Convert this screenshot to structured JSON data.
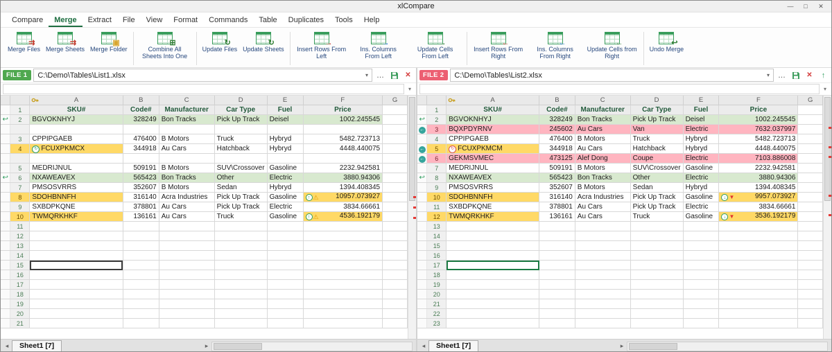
{
  "window": {
    "title": "xlCompare",
    "min": "—",
    "max": "□",
    "close": "✕"
  },
  "colors": {
    "menu-active": "#1e6e41",
    "tb-text": "#26477d",
    "row-green": "#d8e9cf",
    "row-pink": "#ffb5c0",
    "cell-orange": "#ffd966",
    "grid-line": "#d8d8d8",
    "hdr-green": "#21593a",
    "file1-badge": "#4fa84f",
    "file2-badge": "#ec5f72"
  },
  "menu": [
    {
      "label": "Compare"
    },
    {
      "label": "Merge",
      "active": true
    },
    {
      "label": "Extract"
    },
    {
      "label": "File"
    },
    {
      "label": "View"
    },
    {
      "label": "Format"
    },
    {
      "label": "Commands"
    },
    {
      "label": "Table"
    },
    {
      "label": "Duplicates"
    },
    {
      "label": "Tools"
    },
    {
      "label": "Help"
    }
  ],
  "toolbar": [
    {
      "label": "Merge Files",
      "icon": "merge-files",
      "glyph": "⇉",
      "color": "#c0392b"
    },
    {
      "label": "Merge Sheets",
      "icon": "merge-sheets",
      "glyph": "⇉",
      "color": "#c0392b"
    },
    {
      "label": "Merge Folder",
      "icon": "merge-folder",
      "glyph": "▣",
      "color": "#d9a62e",
      "sep": true
    },
    {
      "label": "Combine All Sheets Into One",
      "icon": "combine-sheets",
      "glyph": "⊞",
      "color": "#2e7d32",
      "sep": true
    },
    {
      "label": "Update Files",
      "icon": "update-files",
      "glyph": "↻",
      "color": "#2e7d32"
    },
    {
      "label": "Update Sheets",
      "icon": "update-sheets",
      "glyph": "↻",
      "color": "#2e7d32",
      "sep": true
    },
    {
      "label": "Insert Rows From Left",
      "icon": "insert-rows-left",
      "glyph": "→",
      "color": "#c0392b"
    },
    {
      "label": "Ins. Columns From Left",
      "icon": "insert-columns-left",
      "glyph": "→",
      "color": "#1d6fd1"
    },
    {
      "label": "Update Cells From Left",
      "icon": "update-cells-left",
      "glyph": "→",
      "color": "#2e7d32",
      "sep": true
    },
    {
      "label": "Insert Rows From Right",
      "icon": "insert-rows-right",
      "glyph": "←",
      "color": "#c0392b"
    },
    {
      "label": "Ins. Columns From Right",
      "icon": "insert-columns-right",
      "glyph": "←",
      "color": "#1d6fd1"
    },
    {
      "label": "Update Cells from Right",
      "icon": "update-cells-right",
      "glyph": "←",
      "color": "#2e7d32",
      "sep": true
    },
    {
      "label": "Undo Merge",
      "icon": "undo-merge",
      "glyph": "↩",
      "color": "#2e7d32"
    }
  ],
  "panels": [
    {
      "badge": "FILE 1",
      "badge_color": "#4fa84f",
      "path": "C:\\Demo\\Tables\\List1.xlsx",
      "actions": [
        "ellipsis",
        "save",
        "close"
      ],
      "columns": [
        "A",
        "B",
        "C",
        "D",
        "E",
        "F",
        "G"
      ],
      "key_column": "A",
      "tab": "Sheet1 [7]",
      "sel_row": "15",
      "sel_style": "dark",
      "marks": [
        145,
        160,
        175
      ],
      "rows": [
        {
          "n": "1",
          "h": 1,
          "c": [
            "SKU#",
            "Code#",
            "Manufacturer",
            "Car Type",
            "Fuel",
            "Price"
          ]
        },
        {
          "n": "2",
          "g": "undo",
          "bg": "g",
          "c": [
            "BGVOKNHYJ",
            "328249",
            "Bon Tracks",
            "Pick Up Track",
            "Deisel",
            "1002.245545"
          ]
        },
        {
          "sp": 1
        },
        {
          "n": "3",
          "c": [
            "CPPIPGAEB",
            "476400",
            "B Motors",
            "Truck",
            "Hybryd",
            "5482.723713"
          ]
        },
        {
          "n": "4",
          "nbg": "o",
          "c": [
            {
              "v": "FCUXPKMCX",
              "bg": "o",
              "mk": "g"
            },
            "344918",
            "Au Cars",
            "Hatchback",
            "Hybryd",
            "4448.440075"
          ]
        },
        {
          "sp": 1
        },
        {
          "n": "5",
          "c": [
            "MEDRIJNUL",
            "509191",
            "B Motors",
            "SUV\\Crossover",
            "Gasoline",
            "2232.942581"
          ]
        },
        {
          "n": "6",
          "g": "undo",
          "bg": "g",
          "c": [
            "NXAWEAVEX",
            "565423",
            "Bon Tracks",
            "Other",
            "Electric",
            "3880.94306"
          ]
        },
        {
          "n": "7",
          "c": [
            "PMSOSVRRS",
            "352607",
            "B Motors",
            "Sedan",
            "Hybryd",
            "1394.408345"
          ]
        },
        {
          "n": "8",
          "nbg": "o",
          "c": [
            {
              "v": "SDOHBNNFH",
              "bg": "o"
            },
            "316140",
            "Acra Industries",
            "Pick Up Track",
            "Gasoline",
            {
              "v": "10957.073927",
              "bg": "o",
              "bd": "wu"
            }
          ]
        },
        {
          "n": "9",
          "c": [
            "SXBDPKQNE",
            "378801",
            "Au Cars",
            "Pick Up Track",
            "Electric",
            "3834.66661"
          ]
        },
        {
          "n": "10",
          "nbg": "o",
          "c": [
            {
              "v": "TWMQRKHKF",
              "bg": "o"
            },
            "136161",
            "Au Cars",
            "Truck",
            "Gasoline",
            {
              "v": "4536.192179",
              "bg": "o",
              "bd": "wu"
            }
          ]
        },
        {
          "n": "11"
        },
        {
          "n": "12"
        },
        {
          "n": "13"
        },
        {
          "n": "14"
        },
        {
          "n": "15"
        },
        {
          "n": "16"
        },
        {
          "n": "17"
        },
        {
          "n": "18"
        },
        {
          "n": "19"
        },
        {
          "n": "20"
        },
        {
          "n": "21"
        }
      ]
    },
    {
      "badge": "FILE 2",
      "badge_color": "#ec5f72",
      "path": "C:\\Demo\\Tables\\List2.xlsx",
      "actions": [
        "ellipsis",
        "save",
        "close",
        "up"
      ],
      "columns": [
        "A",
        "B",
        "C",
        "D",
        "E",
        "F",
        "G"
      ],
      "key_column": "A",
      "tab": "Sheet1 [7]",
      "sel_row": "17",
      "sel_style": "green",
      "marks": [
        45,
        73,
        87,
        143,
        171
      ],
      "rows": [
        {
          "n": "1",
          "h": 1,
          "c": [
            "SKU#",
            "Code#",
            "Manufacturer",
            "Car Type",
            "Fuel",
            "Price"
          ]
        },
        {
          "n": "2",
          "g": "undo",
          "bg": "g",
          "c": [
            "BGVOKNHYJ",
            "328249",
            "Bon Tracks",
            "Pick Up Track",
            "Deisel",
            "1002.245545"
          ]
        },
        {
          "n": "3",
          "g": "left",
          "nbg": "p",
          "bg": "p",
          "c": [
            "BQXPDYRNV",
            "245602",
            "Au Cars",
            "Van",
            "Electric",
            "7632.037997"
          ]
        },
        {
          "n": "4",
          "c": [
            "CPPIPGAEB",
            "476400",
            "B Motors",
            "Truck",
            "Hybryd",
            "5482.723713"
          ]
        },
        {
          "n": "5",
          "g": "left",
          "nbg": "o",
          "c": [
            {
              "v": "FCUXPKMCM",
              "bg": "o",
              "mk": "r"
            },
            "344918",
            "Au Cars",
            "Hatchback",
            "Hybryd",
            "4448.440075"
          ]
        },
        {
          "n": "6",
          "g": "left",
          "nbg": "p",
          "bg": "p",
          "c": [
            "GEKMSVMEC",
            "473125",
            "Alef Dong",
            "Coupe",
            "Electric",
            "7103.886008"
          ]
        },
        {
          "n": "7",
          "c": [
            "MEDRIJNUL",
            "509191",
            "B Motors",
            "SUV\\Crossover",
            "Gasoline",
            "2232.942581"
          ]
        },
        {
          "n": "8",
          "g": "undo",
          "bg": "g",
          "c": [
            "NXAWEAVEX",
            "565423",
            "Bon Tracks",
            "Other",
            "Electric",
            "3880.94306"
          ]
        },
        {
          "n": "9",
          "c": [
            "PMSOSVRRS",
            "352607",
            "B Motors",
            "Sedan",
            "Hybryd",
            "1394.408345"
          ]
        },
        {
          "n": "10",
          "nbg": "o",
          "c": [
            {
              "v": "SDOHBNNFH",
              "bg": "o"
            },
            "316140",
            "Acra Industries",
            "Pick Up Track",
            "Gasoline",
            {
              "v": "9957.073927",
              "bg": "o",
              "bd": "wd"
            }
          ]
        },
        {
          "n": "11",
          "c": [
            "SXBDPKQNE",
            "378801",
            "Au Cars",
            "Pick Up Track",
            "Electric",
            "3834.66661"
          ]
        },
        {
          "n": "12",
          "nbg": "o",
          "c": [
            {
              "v": "TWMQRKHKF",
              "bg": "o"
            },
            "136161",
            "Au Cars",
            "Truck",
            "Gasoline",
            {
              "v": "3536.192179",
              "bg": "o",
              "bd": "wd"
            }
          ]
        },
        {
          "n": "13"
        },
        {
          "n": "14"
        },
        {
          "n": "15"
        },
        {
          "n": "16"
        },
        {
          "n": "17"
        },
        {
          "n": "18"
        },
        {
          "n": "19"
        },
        {
          "n": "20"
        },
        {
          "n": "21"
        },
        {
          "n": "22"
        },
        {
          "n": "23"
        }
      ]
    }
  ]
}
